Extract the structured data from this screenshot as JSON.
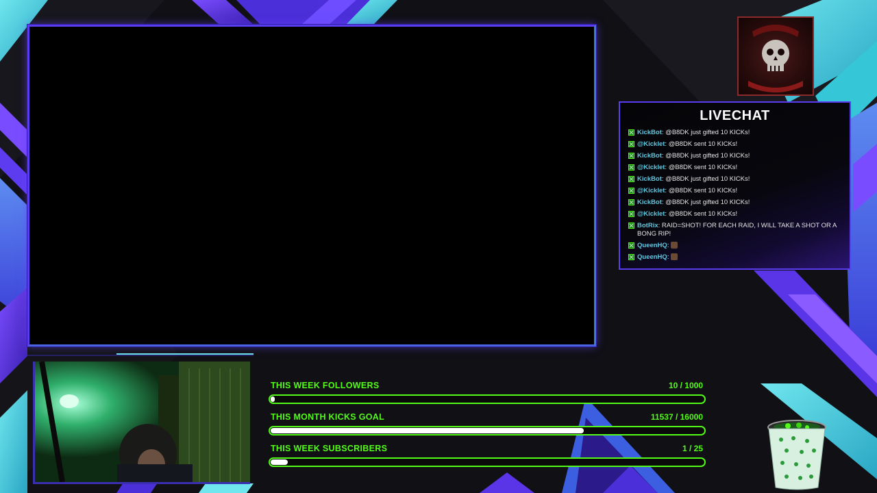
{
  "overlay": {
    "chat": {
      "title": "LIVECHAT",
      "messages": [
        {
          "user": "KickBot",
          "text": ": @B8DK just gifted 10 KICKs!"
        },
        {
          "user": "@Kicklet",
          "text": ": @B8DK sent 10 KICKs!"
        },
        {
          "user": "KickBot",
          "text": ": @B8DK just gifted 10 KICKs!"
        },
        {
          "user": "@Kicklet",
          "text": ": @B8DK sent 10 KICKs!"
        },
        {
          "user": "KickBot",
          "text": ": @B8DK just gifted 10 KICKs!"
        },
        {
          "user": "@Kicklet",
          "text": ": @B8DK sent 10 KICKs!"
        },
        {
          "user": "KickBot",
          "text": ": @B8DK just gifted 10 KICKs!"
        },
        {
          "user": "@Kicklet",
          "text": ": @B8DK sent 10 KICKs!"
        },
        {
          "user": "BotRix",
          "text": ": RAID=SHOT! FOR EACH RAID, I WILL TAKE A SHOT OR A BONG RIP!"
        },
        {
          "user": "QueenHQ",
          "text": ":"
        },
        {
          "user": "QueenHQ",
          "text": ":"
        }
      ]
    },
    "goals": [
      {
        "label": "THIS WEEK FOLLOWERS",
        "value": "10 / 1000",
        "progress": 0.01
      },
      {
        "label": "THIS MONTH KICKS GOAL",
        "value": "11537 / 16000",
        "progress": 0.721
      },
      {
        "label": "THIS WEEK SUBSCRIBERS",
        "value": "1 / 25",
        "progress": 0.04
      }
    ],
    "colors": {
      "accent_green": "#53fc18",
      "frame_purple": "#5b3cf0",
      "cyan": "#4fd6e0",
      "username": "#5ec8e0"
    },
    "icons": [
      "skull-logo-icon",
      "kick-badge-icon",
      "green-bucket-icon"
    ]
  }
}
